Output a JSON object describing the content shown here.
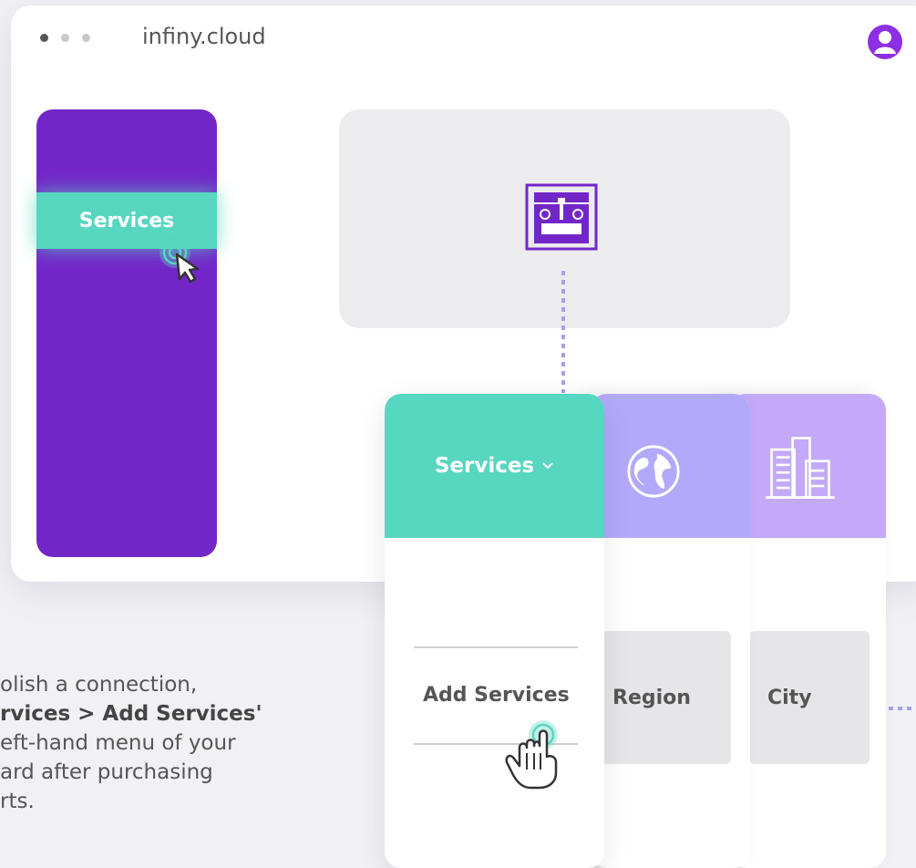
{
  "browser": {
    "title": "infiny.cloud"
  },
  "sidebar": {
    "item_label": "Services"
  },
  "cards": {
    "services": {
      "header": "Services",
      "item": "Add Services"
    },
    "region": {
      "option": "Region"
    },
    "city": {
      "option": "City"
    }
  },
  "description": {
    "line1": "olish a connection,",
    "line2": "rvices > Add Services'",
    "line3": "eft-hand menu of your",
    "line4": "ard after purchasing",
    "line5": "rts."
  },
  "colors": {
    "purple": "#7326c8",
    "teal": "#57d6c0",
    "region_header": "#b3a9fb",
    "city_header": "#c4a9f8",
    "avatar": "#8d2fe2"
  },
  "icons": [
    "user-avatar-icon",
    "router-device-icon",
    "globe-icon",
    "city-buildings-icon",
    "chevron-down-icon",
    "cursor-icon",
    "hand-pointer-icon"
  ]
}
